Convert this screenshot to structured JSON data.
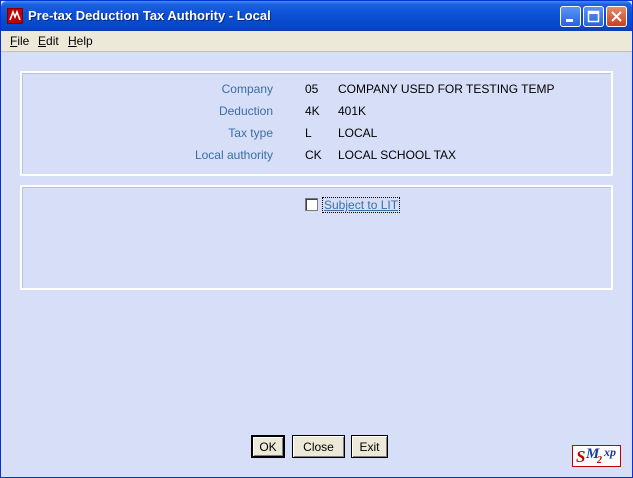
{
  "window": {
    "title": "Pre-tax Deduction Tax Authority - Local"
  },
  "menu": [
    {
      "underline": "F",
      "rest": "ile"
    },
    {
      "underline": "E",
      "rest": "dit"
    },
    {
      "underline": "H",
      "rest": "elp"
    }
  ],
  "info": {
    "company": {
      "label": "Company",
      "code": "05",
      "desc": "COMPANY USED FOR TESTING TEMP"
    },
    "deduction": {
      "label": "Deduction",
      "code": "4K",
      "desc": "401K"
    },
    "tax_type": {
      "label": "Tax type",
      "code": "L",
      "desc": "LOCAL"
    },
    "local_authority": {
      "label": "Local authority",
      "code": "CK",
      "desc": "LOCAL SCHOOL TAX"
    }
  },
  "options": {
    "subject_to_lit": {
      "label": "Subject to LIT",
      "checked": false
    }
  },
  "buttons": {
    "ok": "OK",
    "close": "Close",
    "exit": "Exit"
  },
  "logo": {
    "s": "S",
    "m": "M",
    "two": "2",
    "xp": "xp"
  },
  "colors": {
    "title_bar": "#0a4fd4",
    "label_blue": "#3a6ea5",
    "window_bg": "#d6dff7",
    "logo_red": "#c00000"
  }
}
